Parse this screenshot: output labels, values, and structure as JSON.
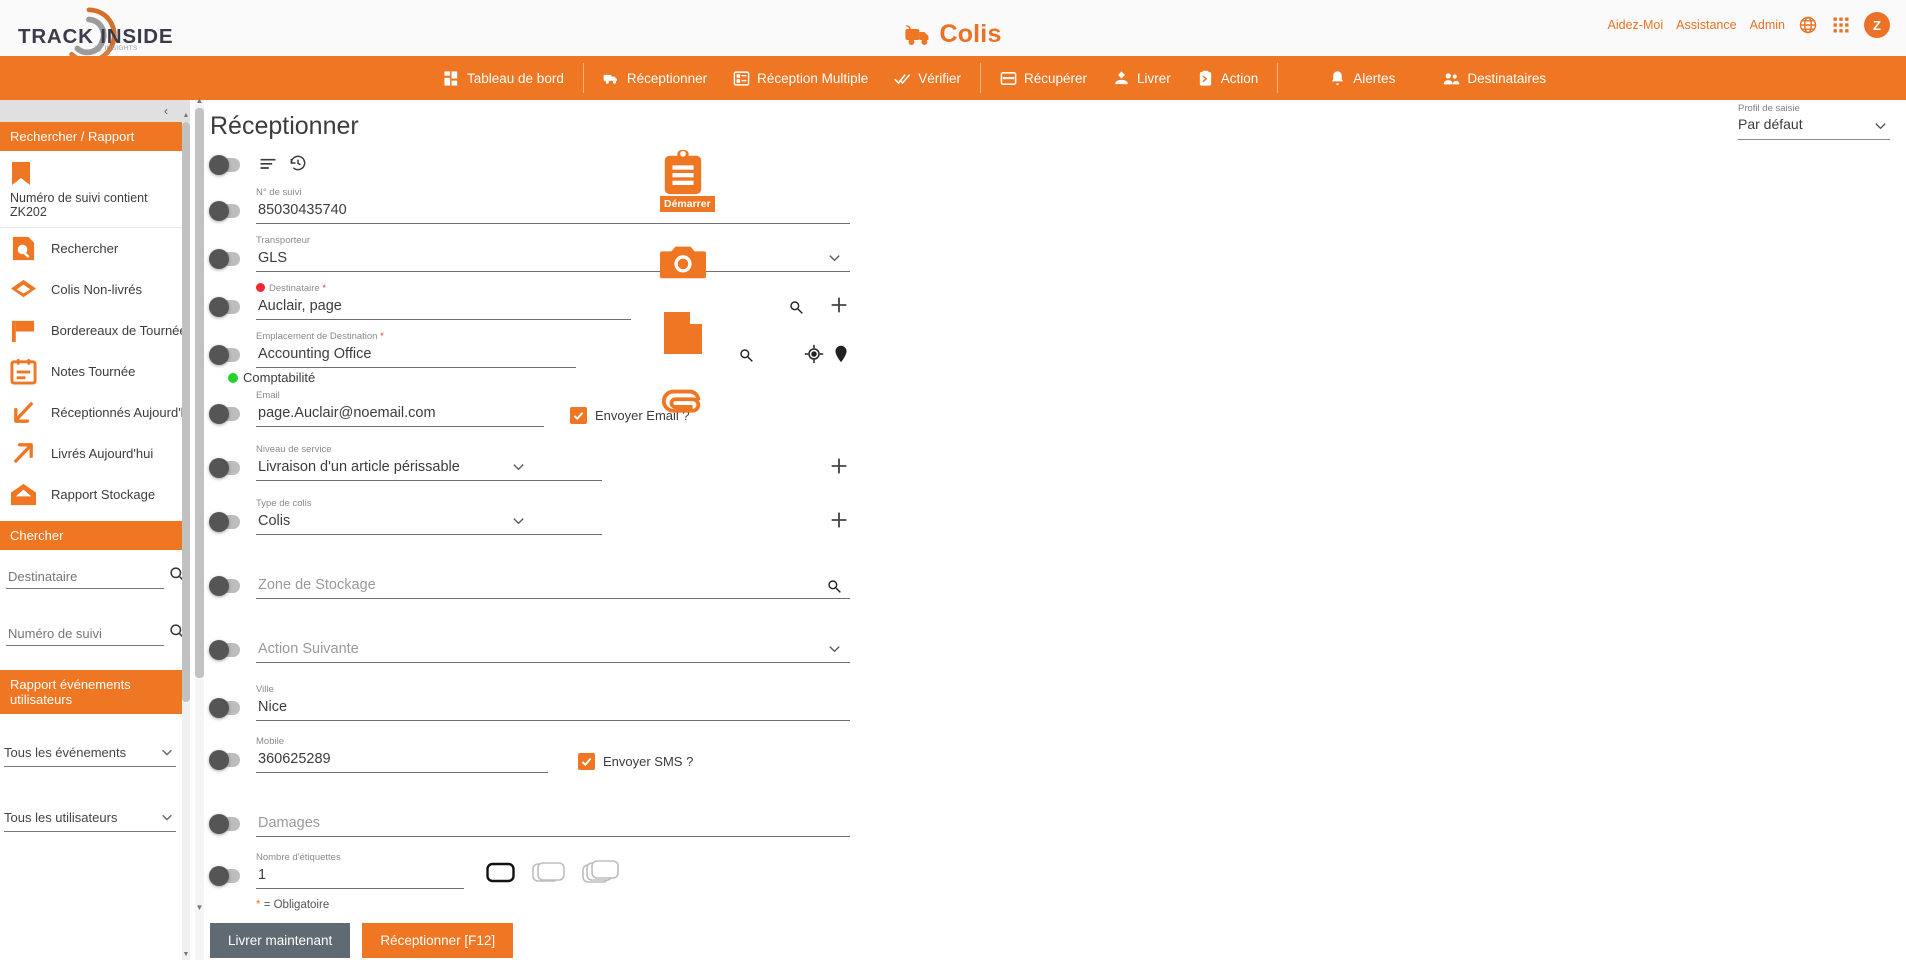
{
  "topbar": {
    "logo_main": "TRACK   INSIDE",
    "logo_sub": "by INSIGHTS",
    "brand_title": "Colis",
    "links": [
      {
        "label": "Aidez-Moi",
        "name": "help-link"
      },
      {
        "label": "Assistance",
        "name": "support-link"
      },
      {
        "label": "Admin",
        "name": "admin-link"
      }
    ],
    "avatar_initial": "Z"
  },
  "nav": {
    "items": [
      {
        "label": "Tableau de bord",
        "icon": "dashboard-icon"
      },
      {
        "label": "Réceptionner",
        "icon": "truck-icon"
      },
      {
        "label": "Réception Multiple",
        "icon": "multi-receive-icon"
      },
      {
        "label": "Vérifier",
        "icon": "check-double-icon"
      },
      {
        "label": "Récupérer",
        "icon": "pickup-icon"
      },
      {
        "label": "Livrer",
        "icon": "deliver-icon"
      },
      {
        "label": "Action",
        "icon": "action-icon"
      },
      {
        "label": "Alertes",
        "icon": "bell-icon"
      },
      {
        "label": "Destinataires",
        "icon": "recipients-icon"
      }
    ]
  },
  "sidebar": {
    "section_search_report": "Rechercher / Rapport",
    "bookmark": {
      "label": "Numéro de suivi contient ZK202",
      "icon": "bookmark-icon"
    },
    "items": [
      {
        "label": "Rechercher",
        "icon": "search-doc-icon"
      },
      {
        "label": "Colis Non-livrés",
        "icon": "envelope-icon"
      },
      {
        "label": "Bordereaux de Tournée",
        "icon": "flag-icon"
      },
      {
        "label": "Notes Tournée",
        "icon": "calendar-icon"
      },
      {
        "label": "Réceptionnés Aujourd'hui",
        "icon": "arrow-down-left-icon"
      },
      {
        "label": "Livrés Aujourd'hui",
        "icon": "arrow-up-right-icon"
      },
      {
        "label": "Rapport Stockage",
        "icon": "open-envelope-icon"
      }
    ],
    "section_search": "Chercher",
    "search_fields": [
      {
        "placeholder": "Destinataire",
        "value": "",
        "name": "sidebar-recipient-input"
      },
      {
        "placeholder": "Numéro de suivi",
        "value": "",
        "name": "sidebar-tracking-input"
      }
    ],
    "section_user_events": "Rapport événements utilisateurs",
    "selects": [
      {
        "value": "Tous les événements",
        "name": "all-events-select"
      },
      {
        "value": "Tous les utilisateurs",
        "name": "all-users-select"
      }
    ]
  },
  "main": {
    "page_title": "Réceptionner",
    "profile": {
      "label": "Profil de saisie",
      "value": "Par défaut"
    },
    "fields": [
      {
        "label": "N° de suivi",
        "value": "85030435740",
        "placeholder": "",
        "required": false,
        "type": "text"
      },
      {
        "label": "Transporteur",
        "value": "GLS",
        "placeholder": "",
        "required": false,
        "type": "select"
      },
      {
        "label": "Destinataire",
        "value": "Auclair, page",
        "placeholder": "",
        "required": true,
        "type": "search-plus",
        "dot": "red"
      },
      {
        "label": "Emplacement de Destination",
        "value": "Accounting Office",
        "placeholder": "",
        "required": true,
        "type": "search-geo",
        "sub_label": "Comptabilité"
      },
      {
        "label": "Email",
        "value": "page.Auclair@noemail.com",
        "placeholder": "",
        "required": false,
        "type": "text-check",
        "check_label": "Envoyer Email ?"
      },
      {
        "label": "Niveau de service",
        "value": "Livraison d'un article périssable",
        "placeholder": "",
        "required": false,
        "type": "select-plus"
      },
      {
        "label": "Type de colis",
        "value": "Colis",
        "placeholder": "",
        "required": false,
        "type": "select-plus"
      },
      {
        "label": "",
        "value": "",
        "placeholder": "Zone de Stockage",
        "required": false,
        "type": "search"
      },
      {
        "label": "",
        "value": "",
        "placeholder": "Action Suivante",
        "required": false,
        "type": "select"
      },
      {
        "label": "Ville",
        "value": "Nice",
        "placeholder": "",
        "required": false,
        "type": "text"
      },
      {
        "label": "Mobile",
        "value": "360625289",
        "placeholder": "",
        "required": false,
        "type": "text-check",
        "check_label": "Envoyer SMS ?"
      },
      {
        "label": "",
        "value": "",
        "placeholder": "Damages",
        "required": false,
        "type": "text"
      },
      {
        "label": "Nombre d'étiquettes",
        "value": "1",
        "placeholder": "",
        "required": false,
        "type": "label-count"
      }
    ],
    "mandatory_note_star": "*",
    "mandatory_note": "= Obligatoire",
    "buttons": {
      "deliver_now": "Livrer maintenant",
      "receive": "Réceptionner [F12]"
    },
    "side_actions": [
      {
        "name": "clipboard-icon",
        "badge": "Démarrer"
      },
      {
        "name": "camera-icon",
        "badge": ""
      },
      {
        "name": "document-icon",
        "badge": ""
      },
      {
        "name": "paperclip-icon",
        "badge": ""
      }
    ]
  },
  "colors": {
    "brand_orange": "#ef7622",
    "grey_button": "#5f6a72",
    "required_red": "#f1282d",
    "status_green": "#22d428"
  }
}
